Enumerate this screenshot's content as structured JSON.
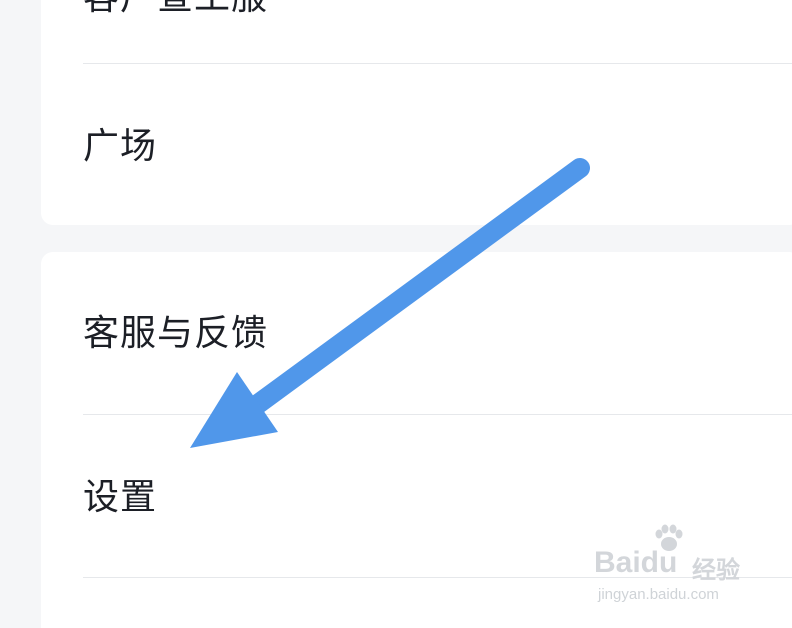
{
  "menu": {
    "top_partial_label": "客户查工服",
    "plaza_label": "广场",
    "support_label": "客服与反馈",
    "settings_label": "设置"
  },
  "colors": {
    "background": "#f5f6f8",
    "card": "#ffffff",
    "text": "#1c1f26",
    "divider": "#e6e8eb",
    "arrow": "#5097ea"
  },
  "watermark": {
    "logo": "Baidu",
    "brand": "经验",
    "url": "jingyan.baidu.com"
  }
}
